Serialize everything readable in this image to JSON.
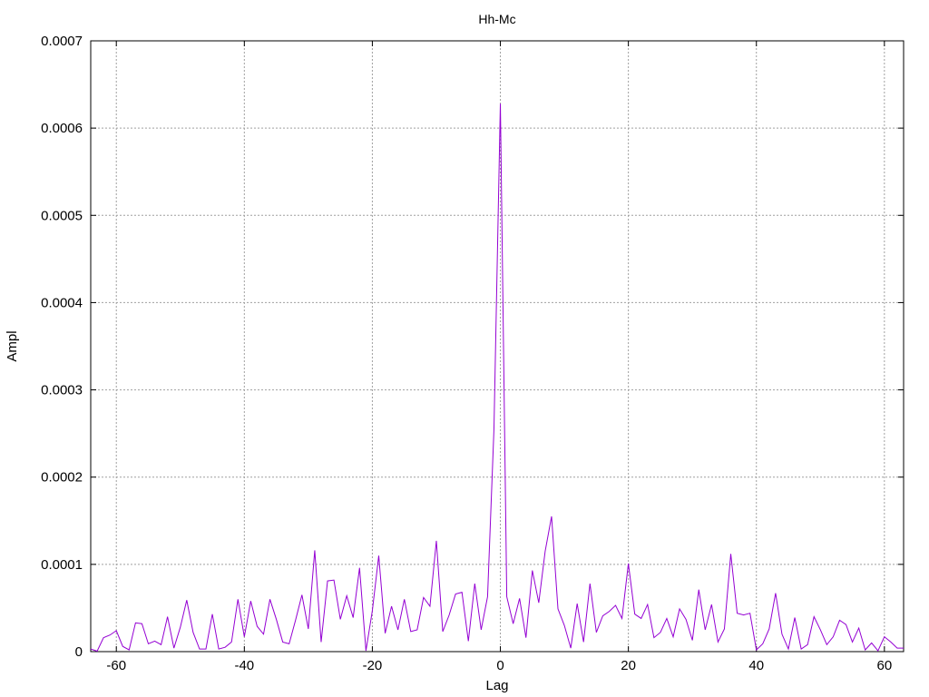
{
  "chart_data": {
    "type": "line",
    "title": "Hh-Mc",
    "xlabel": "Lag",
    "ylabel": "Ampl",
    "xlim": [
      -64,
      63
    ],
    "ylim": [
      0,
      0.0007
    ],
    "x_ticks": [
      -60,
      -40,
      -20,
      0,
      20,
      40,
      60
    ],
    "x_tick_labels": [
      "-60",
      "-40",
      "-20",
      "0",
      "20",
      "40",
      "60"
    ],
    "y_ticks": [
      0,
      0.0001,
      0.0002,
      0.0003,
      0.0004,
      0.0005,
      0.0006,
      0.0007
    ],
    "y_tick_labels": [
      "0",
      "0.0001",
      "0.0002",
      "0.0003",
      "0.0004",
      "0.0005",
      "0.0006",
      "0.0007"
    ],
    "grid": true,
    "line_color": "#9400d3",
    "series": [
      {
        "x": [
          -64,
          -63,
          -62,
          -61,
          -60,
          -59,
          -58,
          -57,
          -56,
          -55,
          -54,
          -53,
          -52,
          -51,
          -50,
          -49,
          -48,
          -47,
          -46,
          -45,
          -44,
          -43,
          -42,
          -41,
          -40,
          -39,
          -38,
          -37,
          -36,
          -35,
          -34,
          -33,
          -32,
          -31,
          -30,
          -29,
          -28,
          -27,
          -26,
          -25,
          -24,
          -23,
          -22,
          -21,
          -20,
          -19,
          -18,
          -17,
          -16,
          -15,
          -14,
          -13,
          -12,
          -11,
          -10,
          -9,
          -8,
          -7,
          -6,
          -5,
          -4,
          -3,
          -2,
          -1,
          0,
          1,
          2,
          3,
          4,
          5,
          6,
          7,
          8,
          9,
          10,
          11,
          12,
          13,
          14,
          15,
          16,
          17,
          18,
          19,
          20,
          21,
          22,
          23,
          24,
          25,
          26,
          27,
          28,
          29,
          30,
          31,
          32,
          33,
          34,
          35,
          36,
          37,
          38,
          39,
          40,
          41,
          42,
          43,
          44,
          45,
          46,
          47,
          48,
          49,
          50,
          51,
          52,
          53,
          54,
          55,
          56,
          57,
          58,
          59,
          60,
          61,
          62,
          63
        ],
        "y": [
          3e-06,
          5e-07,
          1.6e-05,
          1.9e-05,
          2.4e-05,
          6e-06,
          2e-06,
          3.3e-05,
          3.2e-05,
          9e-06,
          1.2e-05,
          8e-06,
          4e-05,
          4e-06,
          2.8e-05,
          5.9e-05,
          2.2e-05,
          3e-06,
          3e-06,
          4.3e-05,
          3e-06,
          5e-06,
          1.1e-05,
          6e-05,
          1.7e-05,
          5.8e-05,
          2.9e-05,
          2e-05,
          6e-05,
          3.7e-05,
          1.1e-05,
          9e-06,
          3.6e-05,
          6.5e-05,
          2.6e-05,
          0.000116,
          1.1e-05,
          8.1e-05,
          8.2e-05,
          3.7e-05,
          6.4e-05,
          3.9e-05,
          9.6e-05,
          1e-06,
          4.7e-05,
          0.00011,
          2.1e-05,
          5.2e-05,
          2.5e-05,
          6e-05,
          2.3e-05,
          2.5e-05,
          6.2e-05,
          5.2e-05,
          0.000127,
          2.3e-05,
          4.2e-05,
          6.6e-05,
          6.8e-05,
          1.2e-05,
          7.8e-05,
          2.5e-05,
          6.3e-05,
          0.000255,
          0.000628,
          6.3e-05,
          3.2e-05,
          6.1e-05,
          1.6e-05,
          9.3e-05,
          5.6e-05,
          0.000115,
          0.000155,
          4.9e-05,
          3e-05,
          4e-06,
          5.5e-05,
          1.1e-05,
          7.8e-05,
          2.2e-05,
          4.1e-05,
          4.6e-05,
          5.3e-05,
          3.8e-05,
          0.000101,
          4.3e-05,
          3.8e-05,
          5.4e-05,
          1.6e-05,
          2.2e-05,
          3.8e-05,
          1.7e-05,
          4.9e-05,
          3.7e-05,
          1.3e-05,
          7.1e-05,
          2.5e-05,
          5.4e-05,
          1.1e-05,
          2.6e-05,
          0.000112,
          4.4e-05,
          4.2e-05,
          4.4e-05,
          2e-06,
          9e-06,
          2.6e-05,
          6.7e-05,
          2e-05,
          3e-06,
          3.9e-05,
          3e-06,
          8e-06,
          4e-05,
          2.5e-05,
          8e-06,
          1.7e-05,
          3.6e-05,
          3.1e-05,
          1.1e-05,
          2.7e-05,
          2e-06,
          1e-05,
          1e-06,
          1.7e-05,
          1.1e-05,
          4e-06,
          4e-06
        ]
      }
    ]
  }
}
